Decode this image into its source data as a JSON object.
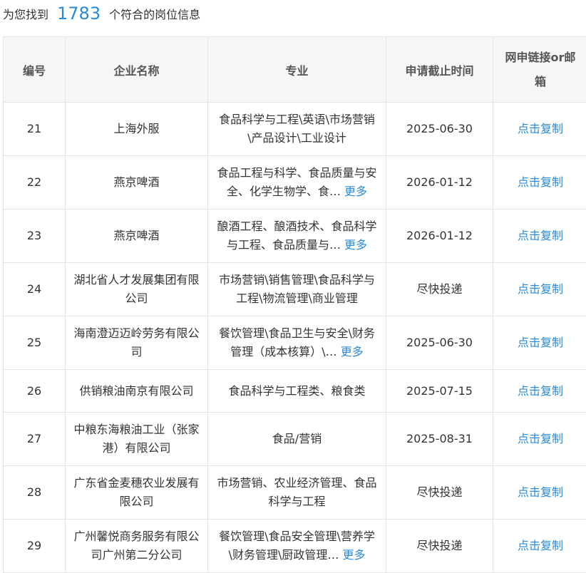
{
  "summary": {
    "prefix": "为您找到",
    "count": "1783",
    "suffix": "个符合的岗位信息"
  },
  "table": {
    "headers": [
      "编号",
      "企业名称",
      "专业",
      "申请截止时间",
      "网申链接or邮箱"
    ],
    "rows": [
      {
        "id": "21",
        "company": "上海外服",
        "major": "食品科学与工程\\英语\\市场营销\\产品设计\\工业设计",
        "more": "",
        "deadline": "2025-06-30",
        "link": "点击复制"
      },
      {
        "id": "22",
        "company": "燕京啤酒",
        "major": "食品工程与科学、食品质量与安全、化学生物学、食…",
        "more": "更多",
        "deadline": "2026-01-12",
        "link": "点击复制"
      },
      {
        "id": "23",
        "company": "燕京啤酒",
        "major": "酿酒工程、酿酒技术、食品科学与工程、食品质量与…",
        "more": "更多",
        "deadline": "2026-01-12",
        "link": "点击复制"
      },
      {
        "id": "24",
        "company": "湖北省人才发展集团有限公司",
        "major": "市场营销\\销售管理\\食品科学与工程\\物流管理\\商业管理",
        "more": "",
        "deadline": "尽快投递",
        "link": "点击复制"
      },
      {
        "id": "25",
        "company": "海南澄迈迈岭劳务有限公司",
        "major": "餐饮管理\\食品卫生与安全\\财务管理（成本核算）\\…",
        "more": "更多",
        "deadline": "2025-06-30",
        "link": "点击复制"
      },
      {
        "id": "26",
        "company": "供销粮油南京有限公司",
        "major": "食品科学与工程类、粮食类",
        "more": "",
        "deadline": "2025-07-15",
        "link": "点击复制"
      },
      {
        "id": "27",
        "company": "中粮东海粮油工业（张家港）有限公司",
        "major": "食品/营销",
        "more": "",
        "deadline": "2025-08-31",
        "link": "点击复制"
      },
      {
        "id": "28",
        "company": "广东省金麦穗农业发展有限公司",
        "major": "市场营销、农业经济管理、食品科学与工程",
        "more": "",
        "deadline": "尽快投递",
        "link": "点击复制"
      },
      {
        "id": "29",
        "company": "广州馨悦商务服务有限公司广州第二分公司",
        "major": "餐饮管理\\食品安全管理\\营养学\\财务管理\\厨政管理…",
        "more": "更多",
        "deadline": "尽快投递",
        "link": "点击复制"
      }
    ]
  }
}
